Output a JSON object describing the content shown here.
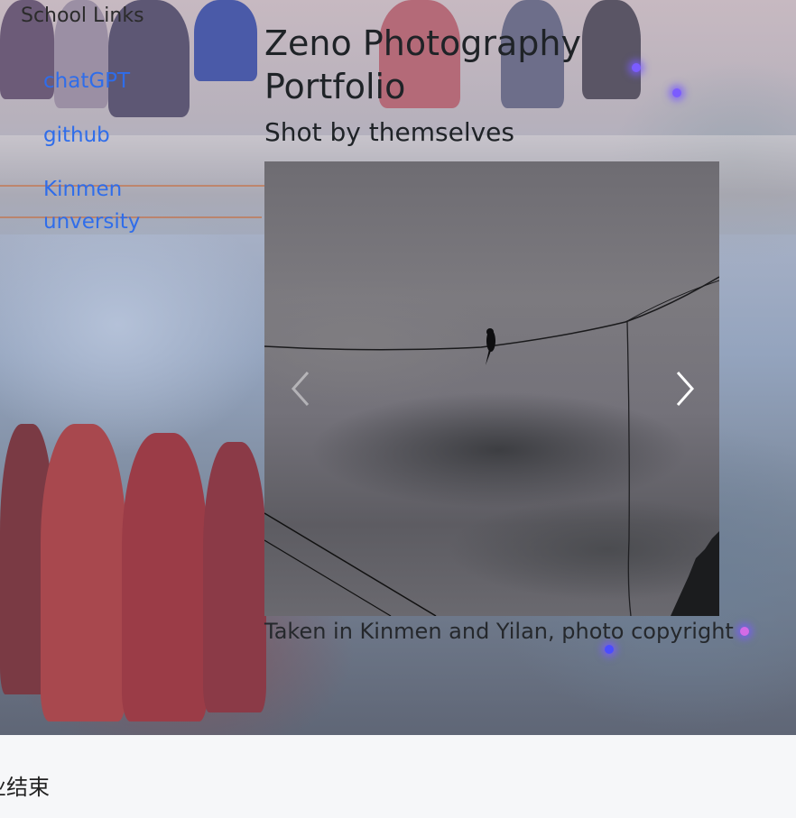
{
  "sidebar": {
    "title": "School Links",
    "links": [
      {
        "label": "chatGPT"
      },
      {
        "label": "github"
      },
      {
        "label": "Kinmen unversity"
      }
    ]
  },
  "header": {
    "title": "Zeno Photography Portfolio",
    "subtitle": "Shot by themselves"
  },
  "carousel": {
    "image_subject": "bird on wire against cloudy sky",
    "prev_icon": "chevron-left-icon",
    "next_icon": "chevron-right-icon",
    "caption": "Taken in Kinmen and Yilan, photo copyright"
  },
  "footer": {
    "text": "业结束"
  },
  "colors": {
    "link": "#2f6dea",
    "text": "#1f2327",
    "footer_bg": "#f6f7f9"
  }
}
